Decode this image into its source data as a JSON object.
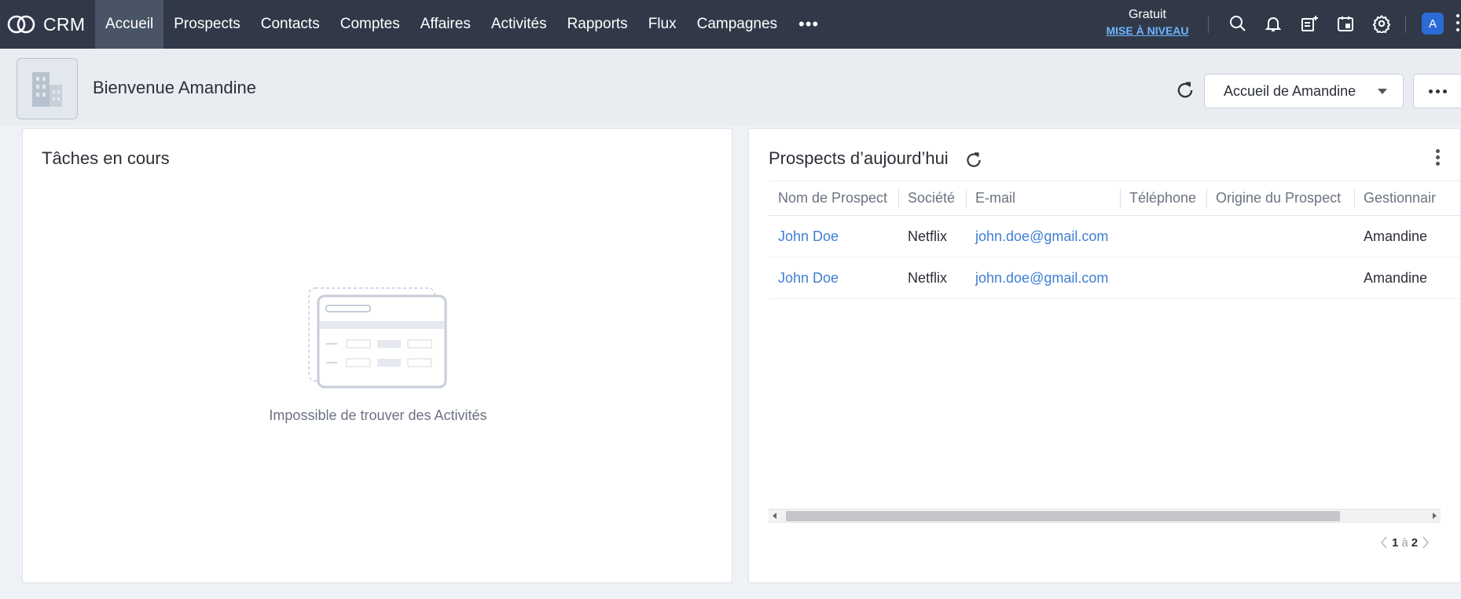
{
  "app": {
    "name": "CRM"
  },
  "nav": {
    "items": [
      {
        "label": "Accueil",
        "active": true
      },
      {
        "label": "Prospects"
      },
      {
        "label": "Contacts"
      },
      {
        "label": "Comptes"
      },
      {
        "label": "Affaires"
      },
      {
        "label": "Activités"
      },
      {
        "label": "Rapports"
      },
      {
        "label": "Flux"
      },
      {
        "label": "Campagnes"
      }
    ],
    "more": "•••"
  },
  "plan": {
    "name": "Gratuit",
    "upgrade": "MISE À NIVEAU"
  },
  "toolbar_icons": [
    "search-icon",
    "bell-icon",
    "add-note-icon",
    "calendar-icon",
    "gear-icon"
  ],
  "user": {
    "avatar_letter": "A"
  },
  "header": {
    "welcome": "Bienvenue Amandine",
    "dashboard_select": "Accueil de Amandine"
  },
  "tasks": {
    "title": "Tâches en cours",
    "empty_message": "Impossible de trouver des Activités"
  },
  "leads": {
    "title": "Prospects d’aujourd’hui",
    "columns": [
      "Nom de Prospect",
      "Société",
      "E-mail",
      "Téléphone",
      "Origine du Prospect",
      "Gestionnair"
    ],
    "rows": [
      {
        "name": "John Doe",
        "company": "Netflix",
        "email": "john.doe@gmail.com",
        "phone": "",
        "source": "",
        "owner": "Amandine"
      },
      {
        "name": "John Doe",
        "company": "Netflix",
        "email": "john.doe@gmail.com",
        "phone": "",
        "source": "",
        "owner": "Amandine"
      }
    ],
    "pager": {
      "current": "1",
      "sep": "à",
      "total": "2"
    }
  },
  "colors": {
    "topbar": "#313949",
    "active_nav": "#4a5467",
    "link": "#3f7fd4",
    "upgrade": "#6fb6ff",
    "avatar": "#2c6ad6"
  }
}
